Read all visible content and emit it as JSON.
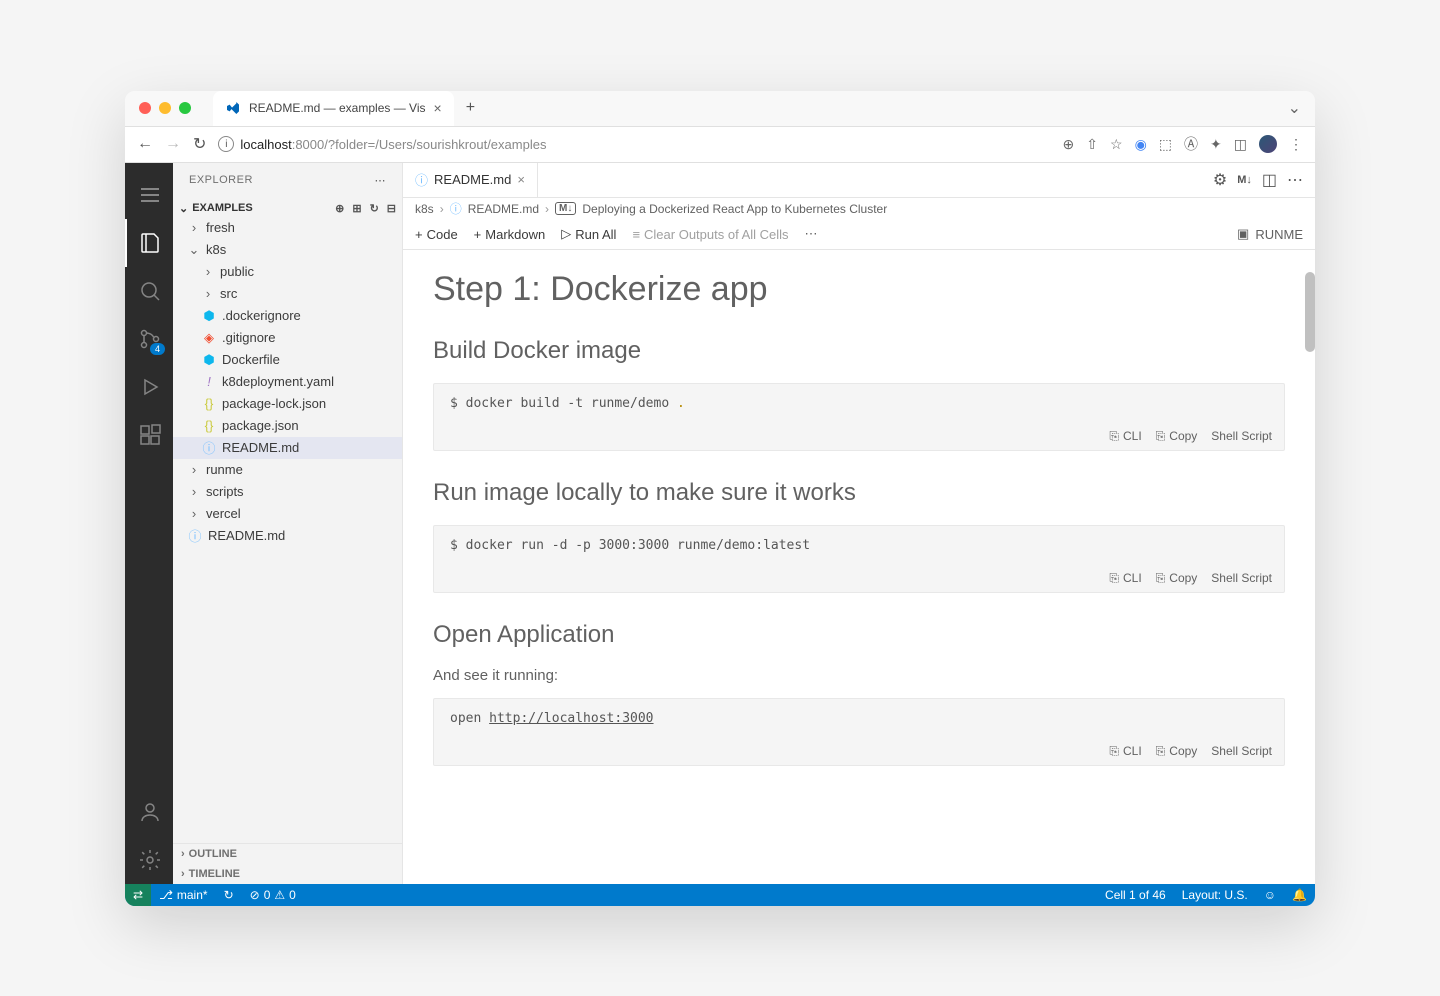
{
  "browser": {
    "tab_title": "README.md — examples — Vis",
    "url_host": "localhost",
    "url_port": ":8000",
    "url_path": "/?folder=/Users/sourishkrout/examples"
  },
  "activity": {
    "scm_badge": "4"
  },
  "sidebar": {
    "title": "EXPLORER",
    "root": "EXAMPLES",
    "tree": {
      "fresh": "fresh",
      "k8s": "k8s",
      "public": "public",
      "src": "src",
      "dockerignore": ".dockerignore",
      "gitignore": ".gitignore",
      "dockerfile": "Dockerfile",
      "k8deployment": "k8deployment.yaml",
      "package_lock": "package-lock.json",
      "package_json": "package.json",
      "readme_k8s": "README.md",
      "runme": "runme",
      "scripts": "scripts",
      "vercel": "vercel",
      "readme_root": "README.md"
    },
    "outline": "OUTLINE",
    "timeline": "TIMELINE"
  },
  "editor": {
    "tab": "README.md",
    "tab_actions": {
      "md": "M↓"
    },
    "breadcrumbs": {
      "b1": "k8s",
      "b2": "README.md",
      "md": "M↓",
      "b3": "Deploying a Dockerized React App to Kubernetes Cluster"
    },
    "toolbar": {
      "code": "Code",
      "markdown": "Markdown",
      "runall": "Run All",
      "clear": "Clear Outputs of All Cells",
      "runme": "RUNME"
    }
  },
  "content": {
    "h1": "Step 1: Dockerize app",
    "h2a": "Build Docker image",
    "code1": "$ docker build -t runme/demo ",
    "code1_dot": ".",
    "h2b": "Run image locally to make sure it works",
    "code2": "$ docker run -d -p 3000:3000 runme/demo:latest",
    "h2c": "Open Application",
    "p1": "And see it running:",
    "code3_prefix": "open ",
    "code3_link": "http://localhost:3000",
    "cellbar": {
      "cli": "CLI",
      "copy": "Copy",
      "shell": "Shell Script"
    }
  },
  "status": {
    "branch": "main*",
    "errors": "0",
    "warnings": "0",
    "cell": "Cell 1 of 46",
    "layout": "Layout: U.S."
  }
}
